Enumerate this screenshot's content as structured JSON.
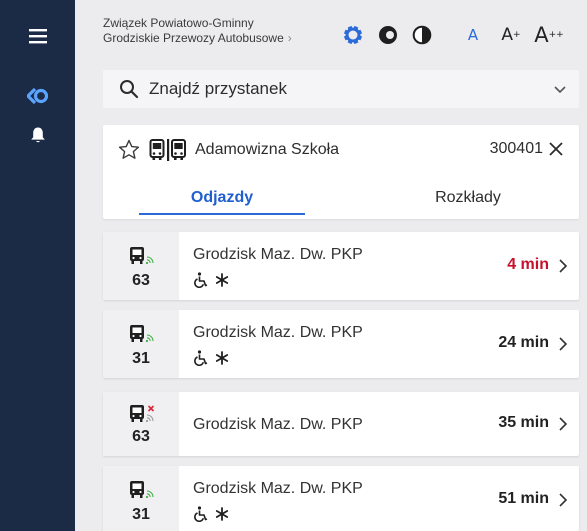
{
  "org": {
    "line1": "Związek Powiatowo-Gminny",
    "line2": "Grodziskie Przewozy Autobusowe"
  },
  "font_sizes": {
    "normal": "A",
    "larger": "A",
    "larger_sup": "+",
    "largest": "A",
    "largest_sup": "++"
  },
  "search": {
    "placeholder": "Znajdź przystanek"
  },
  "stop": {
    "name": "Adamowizna Szkoła",
    "code": "300401"
  },
  "tabs": {
    "departures": "Odjazdy",
    "timetables": "Rozkłady"
  },
  "departures": [
    {
      "line": "63",
      "destination": "Grodzisk Maz. Dw. PKP",
      "time": "4 min",
      "realtime": true,
      "accessible": true,
      "asterisk": true,
      "soon": true
    },
    {
      "line": "31",
      "destination": "Grodzisk Maz. Dw. PKP",
      "time": "24 min",
      "realtime": true,
      "accessible": true,
      "asterisk": true,
      "soon": false
    },
    {
      "line": "63",
      "destination": "Grodzisk Maz. Dw. PKP",
      "time": "35 min",
      "realtime": false,
      "accessible": false,
      "asterisk": false,
      "soon": false
    },
    {
      "line": "31",
      "destination": "Grodzisk Maz. Dw. PKP",
      "time": "51 min",
      "realtime": true,
      "accessible": true,
      "asterisk": true,
      "soon": false
    }
  ],
  "colors": {
    "sidebar": "#1c2b45",
    "accent": "#2a6bd8",
    "soon": "#c8102e",
    "realtime_signal": "#3cb043",
    "no_signal": "#d9283a"
  },
  "icons": [
    "menu-icon",
    "logo-icon",
    "bell-icon",
    "settings-ring-icon",
    "contrast-icon",
    "half-contrast-icon",
    "search-icon",
    "chevron-down-icon",
    "star-icon",
    "bus-stop-icon",
    "close-icon",
    "bus-icon",
    "signal-icon",
    "wheelchair-icon",
    "asterisk-icon",
    "chevron-right-icon"
  ]
}
